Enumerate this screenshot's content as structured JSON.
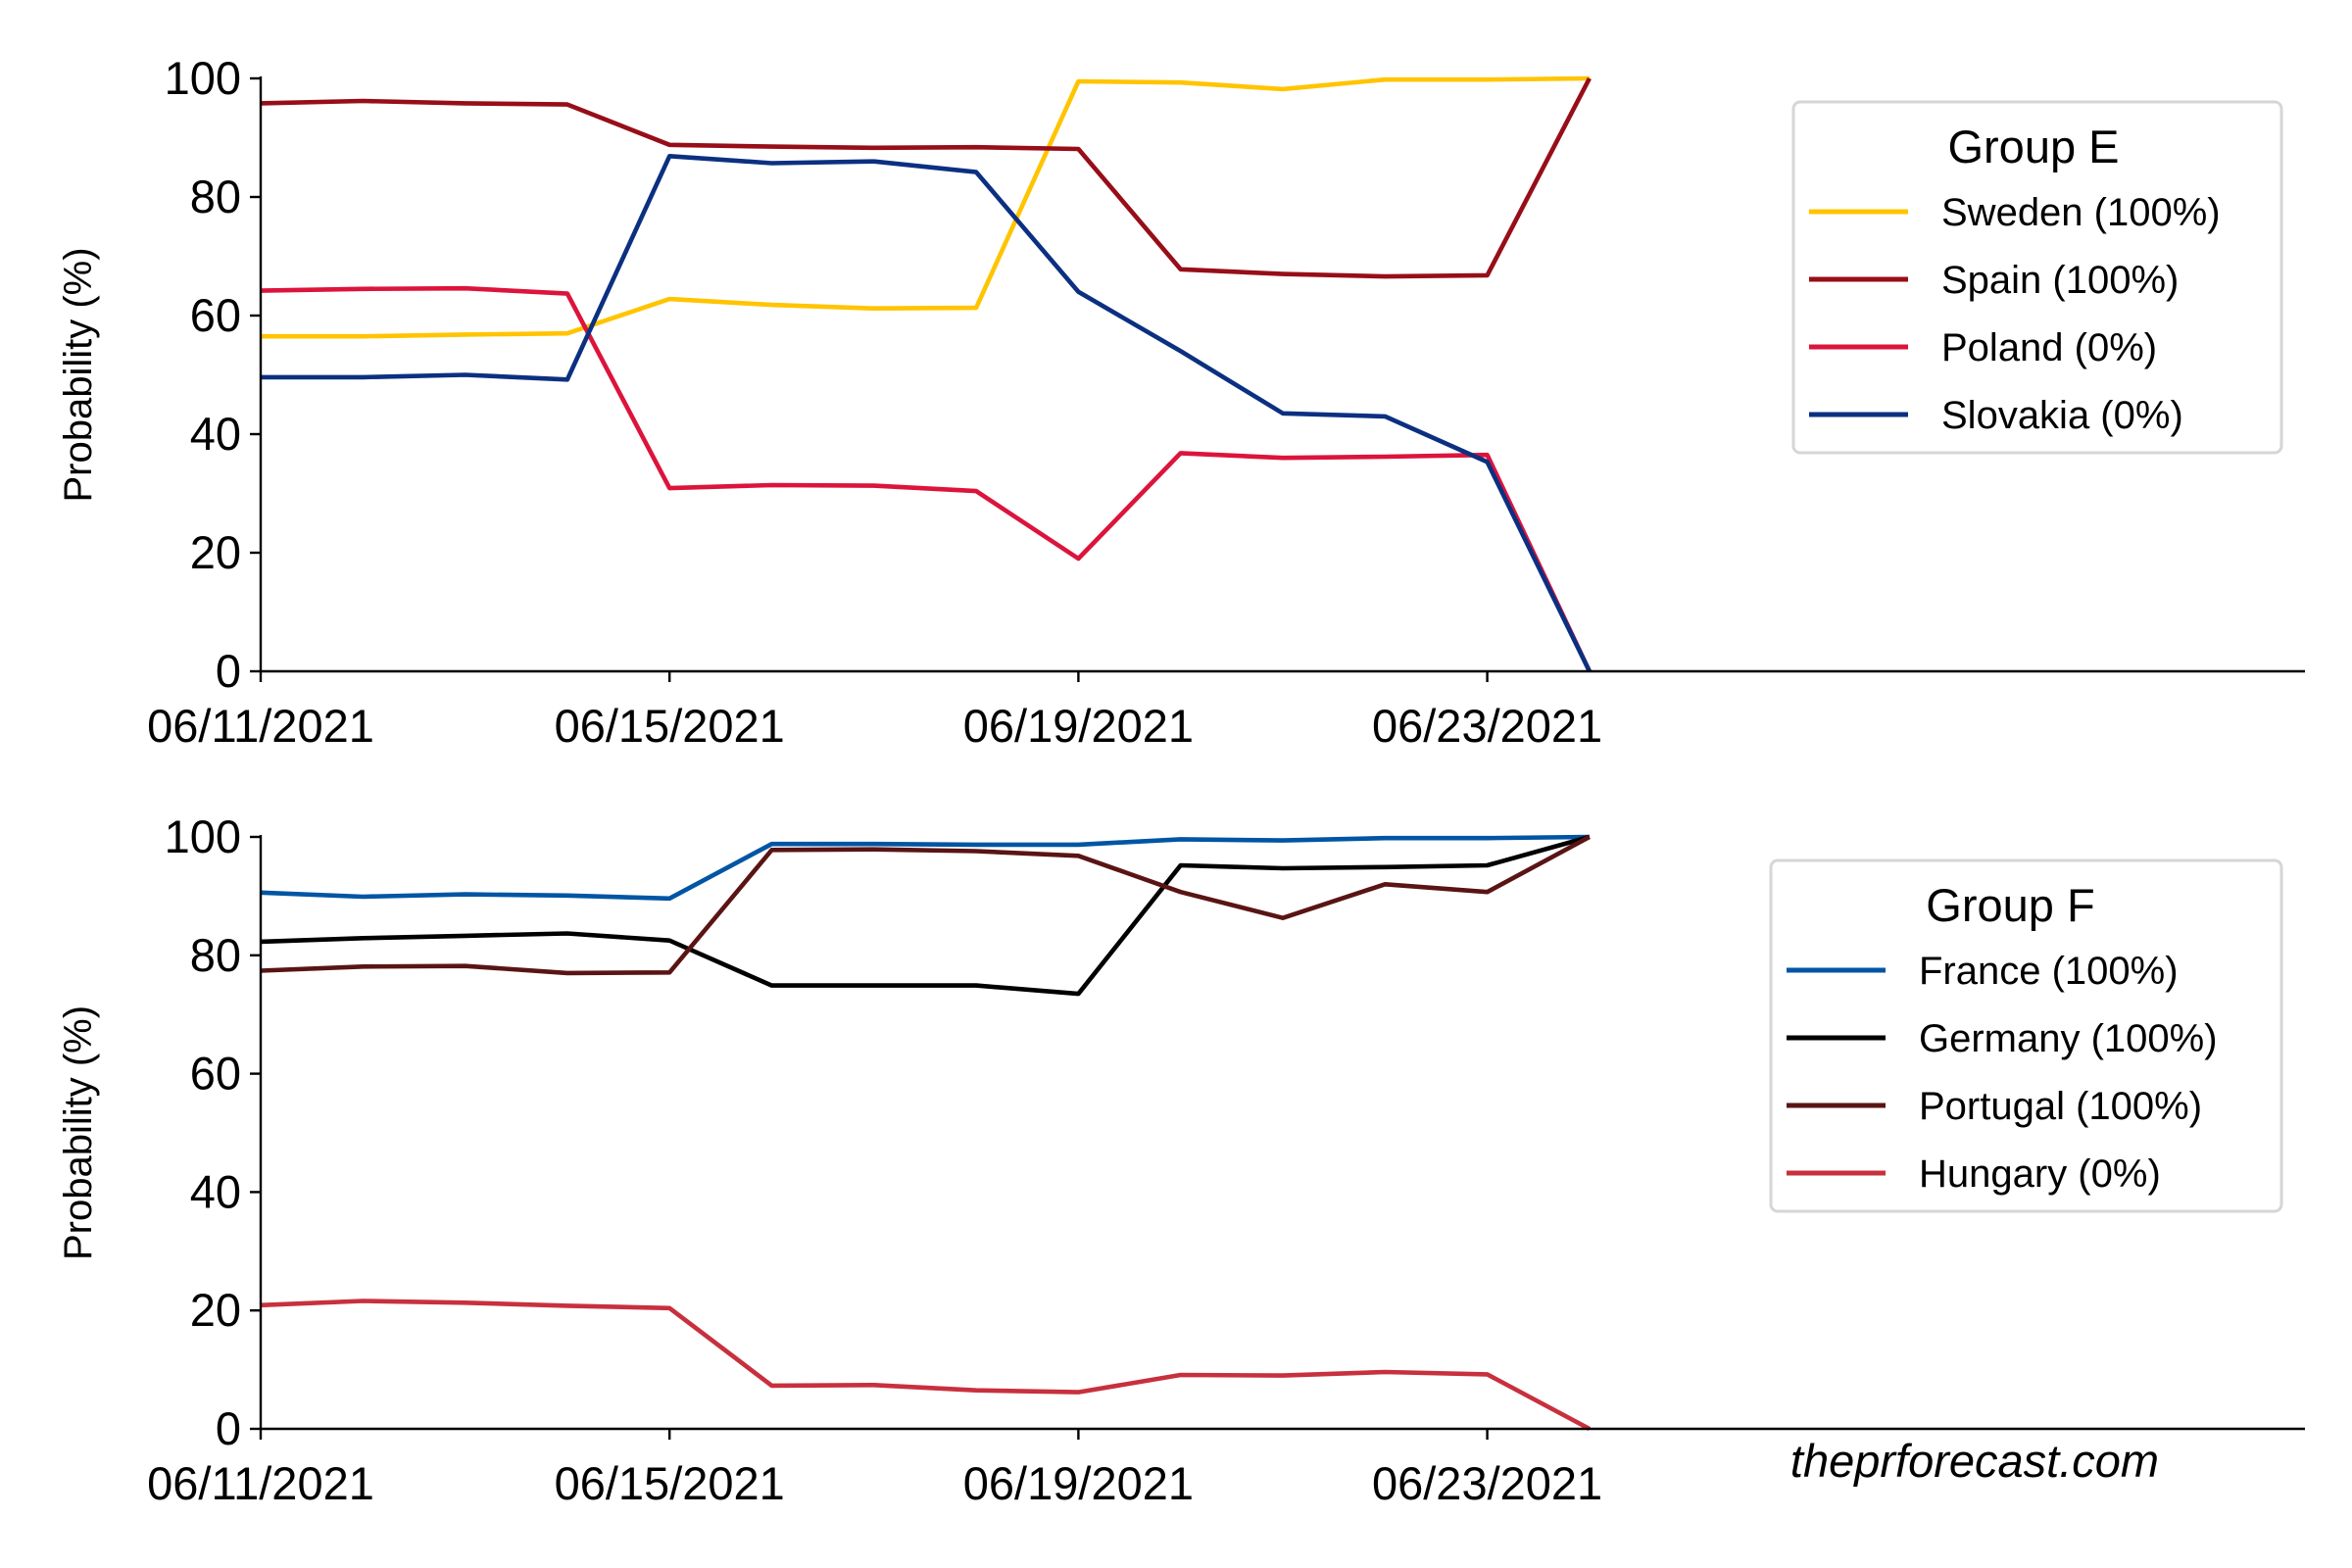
{
  "chart_data": [
    {
      "type": "line",
      "title": "",
      "xlabel": "",
      "ylabel": "Probability (%)",
      "ylim": [
        0,
        100
      ],
      "yticks": [
        "0",
        "20",
        "40",
        "60",
        "80",
        "100"
      ],
      "xtick_labels": [
        "06/11/2021",
        "06/15/2021",
        "06/19/2021",
        "06/23/2021"
      ],
      "xtick_positions": [
        0,
        4,
        8,
        12
      ],
      "x_range": [
        0,
        20
      ],
      "grid": false,
      "x": [
        "06/11/2021",
        "06/12/2021",
        "06/13/2021",
        "06/14/2021",
        "06/15/2021",
        "06/16/2021",
        "06/17/2021",
        "06/18/2021",
        "06/19/2021",
        "06/20/2021",
        "06/21/2021",
        "06/22/2021",
        "06/23/2021",
        "06/24/2021"
      ],
      "legend": {
        "title": "Group E",
        "placement": "top-right"
      },
      "series": [
        {
          "name": "Sweden",
          "label": "Sweden (100%)",
          "color": "#FFC400",
          "values": [
            56.5,
            56.5,
            56.8,
            57.0,
            62.8,
            61.8,
            61.2,
            61.3,
            99.5,
            99.3,
            98.2,
            99.8,
            99.8,
            100
          ]
        },
        {
          "name": "Spain",
          "label": "Spain (100%)",
          "color": "#970E18",
          "values": [
            95.8,
            96.2,
            95.8,
            95.6,
            88.8,
            88.5,
            88.3,
            88.4,
            88.1,
            67.8,
            67.0,
            66.6,
            66.8,
            100
          ]
        },
        {
          "name": "Poland",
          "label": "Poland (0%)",
          "color": "#DC143C",
          "values": [
            64.2,
            64.5,
            64.6,
            63.7,
            30.9,
            31.4,
            31.3,
            30.4,
            19.0,
            36.8,
            36.0,
            36.2,
            36.5,
            0
          ]
        },
        {
          "name": "Slovakia",
          "label": "Slovakia (0%)",
          "color": "#0B3081",
          "values": [
            49.6,
            49.6,
            50.0,
            49.2,
            86.9,
            85.7,
            86.0,
            84.2,
            64.0,
            54.0,
            43.5,
            43.0,
            35.3,
            0
          ]
        }
      ]
    },
    {
      "type": "line",
      "title": "",
      "xlabel": "",
      "ylabel": "Probability (%)",
      "ylim": [
        0,
        100
      ],
      "yticks": [
        "0",
        "20",
        "40",
        "60",
        "80",
        "100"
      ],
      "xtick_labels": [
        "06/11/2021",
        "06/15/2021",
        "06/19/2021",
        "06/23/2021"
      ],
      "xtick_positions": [
        0,
        4,
        8,
        12
      ],
      "x_range": [
        0,
        20
      ],
      "grid": false,
      "x": [
        "06/11/2021",
        "06/12/2021",
        "06/13/2021",
        "06/14/2021",
        "06/15/2021",
        "06/16/2021",
        "06/17/2021",
        "06/18/2021",
        "06/19/2021",
        "06/20/2021",
        "06/21/2021",
        "06/22/2021",
        "06/23/2021",
        "06/24/2021"
      ],
      "legend": {
        "title": "Group F",
        "placement": "top-right"
      },
      "series": [
        {
          "name": "France",
          "label": "France (100%)",
          "color": "#0055A4",
          "values": [
            90.6,
            89.9,
            90.3,
            90.1,
            89.6,
            98.8,
            98.8,
            98.7,
            98.7,
            99.6,
            99.4,
            99.8,
            99.8,
            100
          ]
        },
        {
          "name": "Germany",
          "label": "Germany (100%)",
          "color": "#000000",
          "values": [
            82.3,
            82.9,
            83.3,
            83.7,
            82.5,
            74.9,
            74.9,
            74.9,
            73.5,
            95.2,
            94.7,
            94.9,
            95.2,
            100
          ]
        },
        {
          "name": "Portugal",
          "label": "Portugal (100%)",
          "color": "#5A1414",
          "values": [
            77.4,
            78.1,
            78.2,
            77.0,
            77.1,
            97.8,
            97.9,
            97.6,
            96.8,
            90.7,
            86.3,
            92.0,
            90.7,
            100
          ]
        },
        {
          "name": "Hungary",
          "label": "Hungary (0%)",
          "color": "#C8303D",
          "values": [
            20.9,
            21.6,
            21.3,
            20.8,
            20.4,
            7.3,
            7.4,
            6.5,
            6.2,
            9.1,
            9.0,
            9.6,
            9.2,
            0
          ]
        }
      ]
    }
  ],
  "watermark": "theprforecast.com"
}
